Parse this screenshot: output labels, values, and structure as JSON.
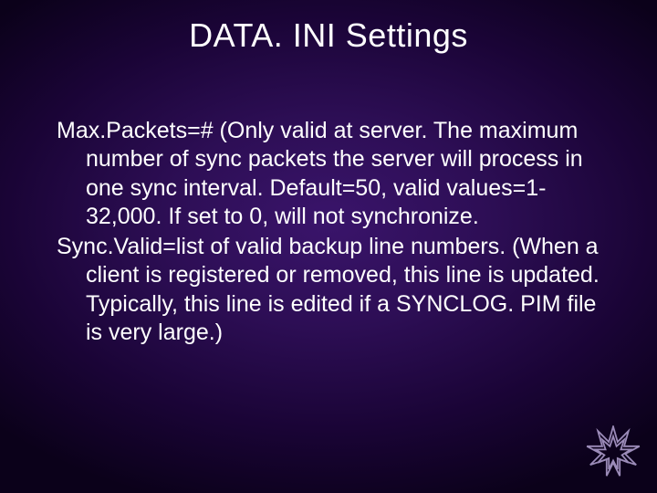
{
  "title": "DATA. INI Settings",
  "paragraphs": [
    "Max.Packets=# (Only valid at server.  The maximum number of sync packets the server will process in one sync interval.  Default=50, valid values=1-32,000.  If set to 0, will not synchronize.",
    "Sync.Valid=list of valid backup line numbers.  (When a client is registered or removed, this line is updated.  Typically, this line is edited if a SYNCLOG. PIM file is very large.)"
  ]
}
